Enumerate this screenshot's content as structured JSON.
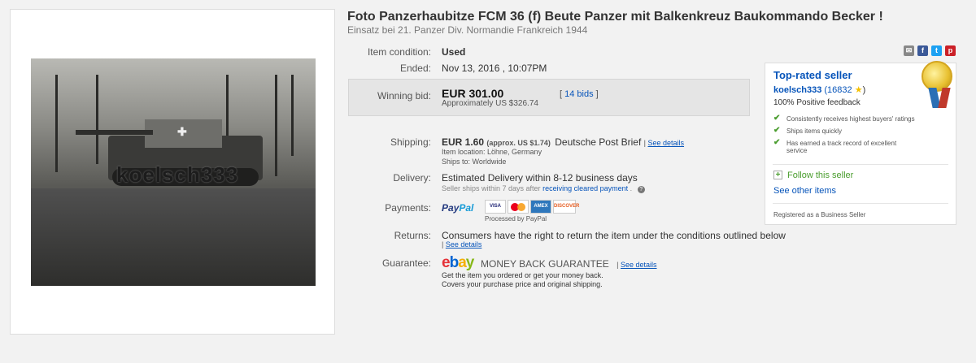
{
  "listing": {
    "title": "Foto Panzerhaubitze FCM 36 (f) Beute Panzer mit Balkenkreuz Baukommando Becker !",
    "subtitle": "Einsatz bei 21. Panzer Div. Normandie Frankreich 1944",
    "photo_watermark": "koelsch333",
    "photo_icon": "tank-photo"
  },
  "details": {
    "condition_label": "Item condition:",
    "condition_value": "Used",
    "ended_label": "Ended:",
    "ended_value": "Nov 13, 2016 , 10:07PM",
    "winning_label": "Winning bid:",
    "winning_amount": "EUR 301.00",
    "winning_approx": "Approximately US $326.74",
    "bids_open": "[",
    "bids_link": "14 bids",
    "bids_close": "]",
    "shipping_label": "Shipping:",
    "shipping_amount": "EUR 1.60",
    "shipping_approx": "(approx. US $1.74)",
    "shipping_service": "Deutsche Post Brief",
    "see_details": "See details",
    "item_location": "Item location:  Löhne, Germany",
    "ships_to": "Ships to:  Worldwide",
    "delivery_label": "Delivery:",
    "delivery_value": "Estimated Delivery within 8-12 business days",
    "delivery_note": "Seller ships within 7 days after",
    "delivery_link": "receiving cleared payment",
    "payments_label": "Payments:",
    "paypal_part1": "Pay",
    "paypal_part2": "Pal",
    "processed_by": "Processed by PayPal",
    "cards": [
      "VISA",
      "MC",
      "AMEX",
      "DISCOVER"
    ],
    "returns_label": "Returns:",
    "returns_value": "Consumers have the right to return the item under the conditions outlined below",
    "guarantee_label": "Guarantee:",
    "mbg_text": "MONEY BACK GUARANTEE",
    "guarantee_line1": "Get the item you ordered or get your money back.",
    "guarantee_line2": "Covers your purchase price and original shipping."
  },
  "ebay_logo": {
    "e": "e",
    "b": "b",
    "a": "a",
    "y": "y"
  },
  "social": [
    "email-icon",
    "facebook-icon",
    "twitter-icon",
    "pinterest-icon"
  ],
  "seller": {
    "box_title": "Top-rated seller",
    "name": "koelsch333",
    "feedback_score": "(16832",
    "feedback_close": ")",
    "positive": "100% Positive feedback",
    "points": [
      "Consistently receives highest buyers' ratings",
      "Ships items quickly",
      "Has earned a track record of excellent service"
    ],
    "follow": "Follow this seller",
    "other_items": "See other items",
    "registered": "Registered as a Business Seller"
  },
  "colors": {
    "link": "#0654ba",
    "follow_green": "#4a9d2e",
    "ebay_red": "#e53238",
    "ebay_blue": "#0064d2",
    "ebay_yellow": "#f5af02",
    "ebay_green": "#86b817"
  }
}
